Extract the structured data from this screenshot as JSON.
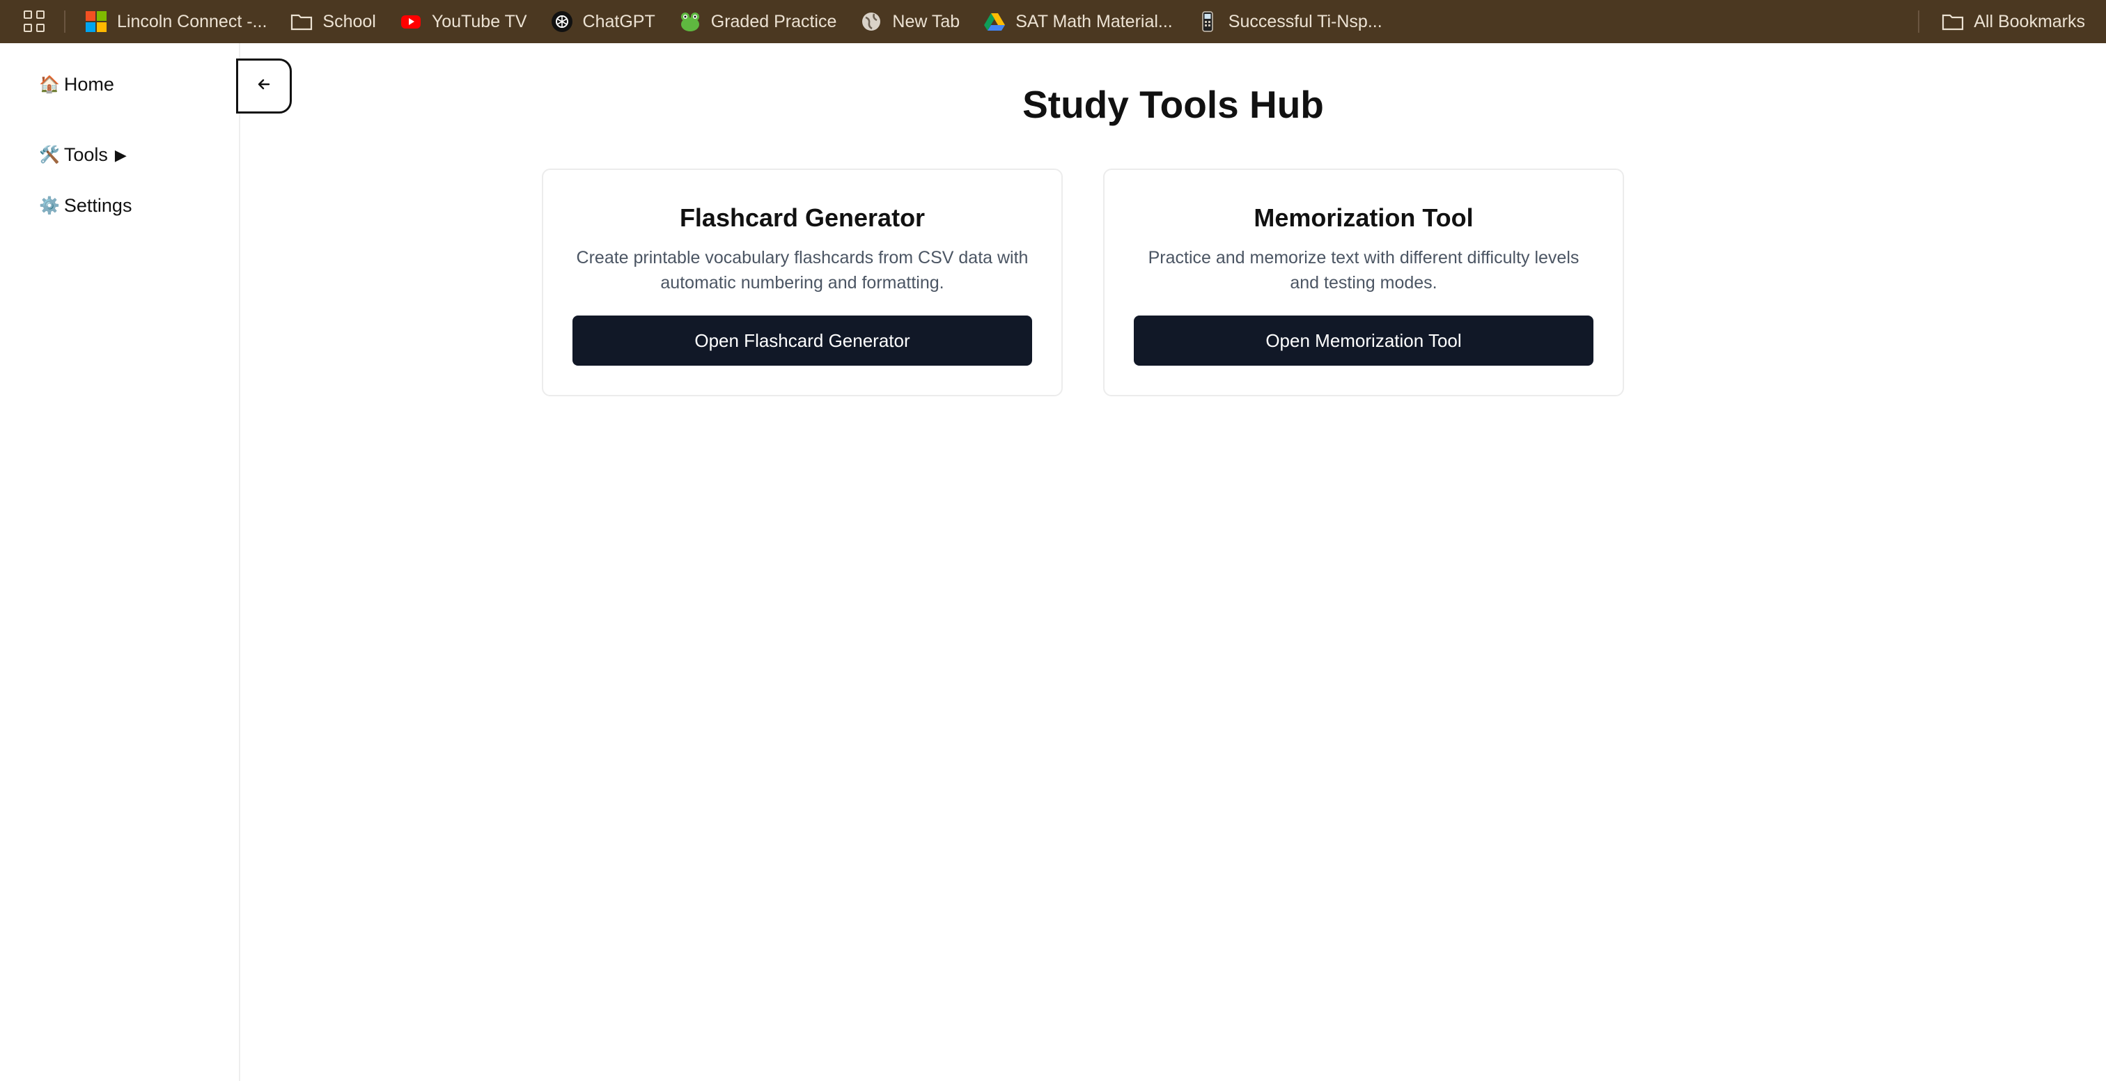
{
  "bookmarks": {
    "items": [
      {
        "label": "Lincoln Connect -...",
        "icon": "microsoft-icon"
      },
      {
        "label": "School",
        "icon": "folder-icon"
      },
      {
        "label": "YouTube TV",
        "icon": "youtube-icon"
      },
      {
        "label": "ChatGPT",
        "icon": "chatgpt-icon"
      },
      {
        "label": "Graded Practice",
        "icon": "frog-icon"
      },
      {
        "label": "New Tab",
        "icon": "globe-icon"
      },
      {
        "label": "SAT Math Material...",
        "icon": "google-drive-icon"
      },
      {
        "label": "Successful Ti-Nsp...",
        "icon": "calculator-icon"
      }
    ],
    "all_bookmarks": "All Bookmarks",
    "bar_color": "#4b3821"
  },
  "sidebar": {
    "home": {
      "emoji": "🏠",
      "label": "Home"
    },
    "tools": {
      "emoji": "🛠️",
      "label": "Tools",
      "arrow": "▶"
    },
    "settings": {
      "emoji": "⚙️",
      "label": "Settings"
    }
  },
  "main": {
    "title": "Study Tools Hub",
    "cards": [
      {
        "title": "Flashcard Generator",
        "description": "Create printable vocabulary flashcards from CSV data with automatic numbering and formatting.",
        "button": "Open Flashcard Generator"
      },
      {
        "title": "Memorization Tool",
        "description": "Practice and memorize text with different difficulty levels and testing modes.",
        "button": "Open Memorization Tool"
      }
    ]
  },
  "colors": {
    "button_bg": "#111827",
    "text_muted": "#4b5563"
  }
}
